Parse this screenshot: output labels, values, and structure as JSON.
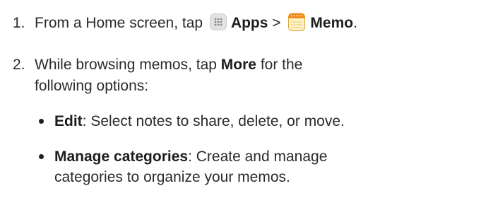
{
  "step1": {
    "number": "1.",
    "prefix": "From a Home screen, tap",
    "apps_label": "Apps",
    "separator": ">",
    "memo_label": "Memo",
    "suffix": ".",
    "apps_icon": "apps-grid-icon",
    "memo_icon": "memo-notepad-icon"
  },
  "step2": {
    "number": "2.",
    "line1_prefix": "While browsing memos, tap",
    "more_label": "More",
    "line1_suffix": "for the",
    "line2": "following options:"
  },
  "options": [
    {
      "term": "Edit",
      "desc_line1": ": Select notes to share, delete, or move.",
      "desc_line2": ""
    },
    {
      "term": "Manage categories",
      "desc_line1": ": Create and manage",
      "desc_line2": "categories to organize your memos."
    }
  ],
  "colors": {
    "text": "#2b2b2b",
    "memo_icon_top": "#f08a1c",
    "memo_icon_body": "#fdf2c4"
  }
}
